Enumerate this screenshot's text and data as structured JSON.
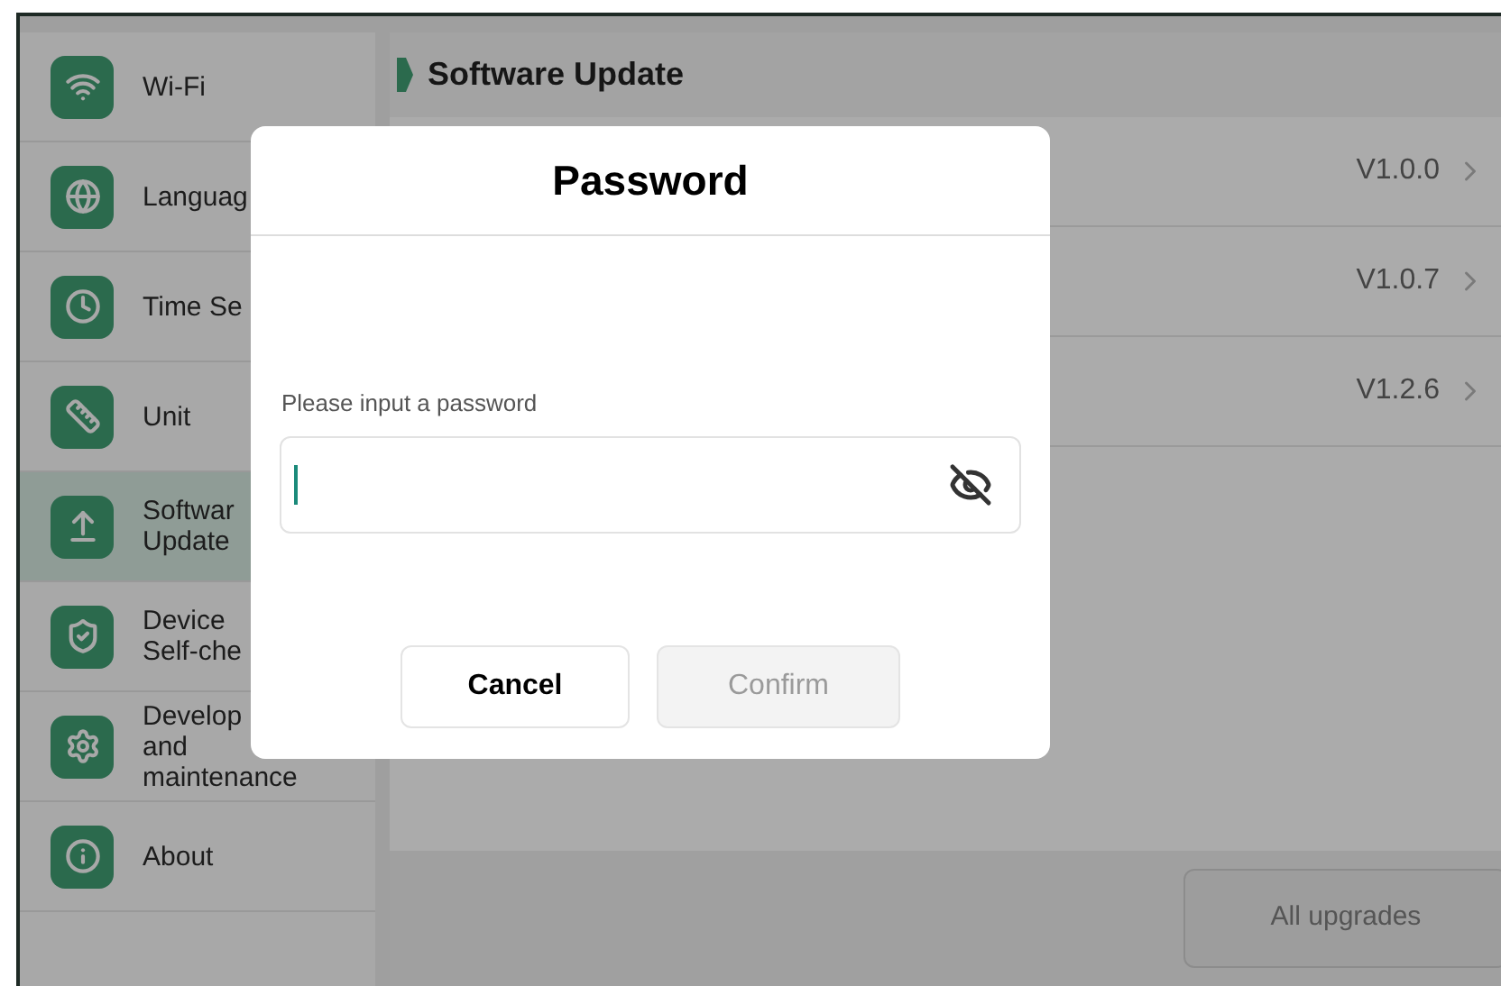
{
  "sidebar": {
    "items": [
      {
        "lines": [
          "Wi-Fi"
        ],
        "selected": false
      },
      {
        "lines": [
          "Languag"
        ],
        "selected": false
      },
      {
        "lines": [
          "Time Se"
        ],
        "selected": false
      },
      {
        "lines": [
          "Unit"
        ],
        "selected": false
      },
      {
        "lines": [
          "Softwar",
          "Update"
        ],
        "selected": true
      },
      {
        "lines": [
          "Device",
          "Self-che"
        ],
        "selected": false
      },
      {
        "lines": [
          "Develop",
          "and",
          "maintenance"
        ],
        "selected": false
      },
      {
        "lines": [
          "About"
        ],
        "selected": false
      }
    ]
  },
  "header": {
    "title": "Software Update"
  },
  "rows": [
    {
      "version": "V1.0.0"
    },
    {
      "version": "V1.0.7"
    },
    {
      "version": "V1.2.6"
    }
  ],
  "footer": {
    "button": "All upgrades"
  },
  "dialog": {
    "title": "Password",
    "field_label": "Please input a password",
    "cancel": "Cancel",
    "confirm": {
      "label": "Confirm",
      "disabled": true
    }
  }
}
